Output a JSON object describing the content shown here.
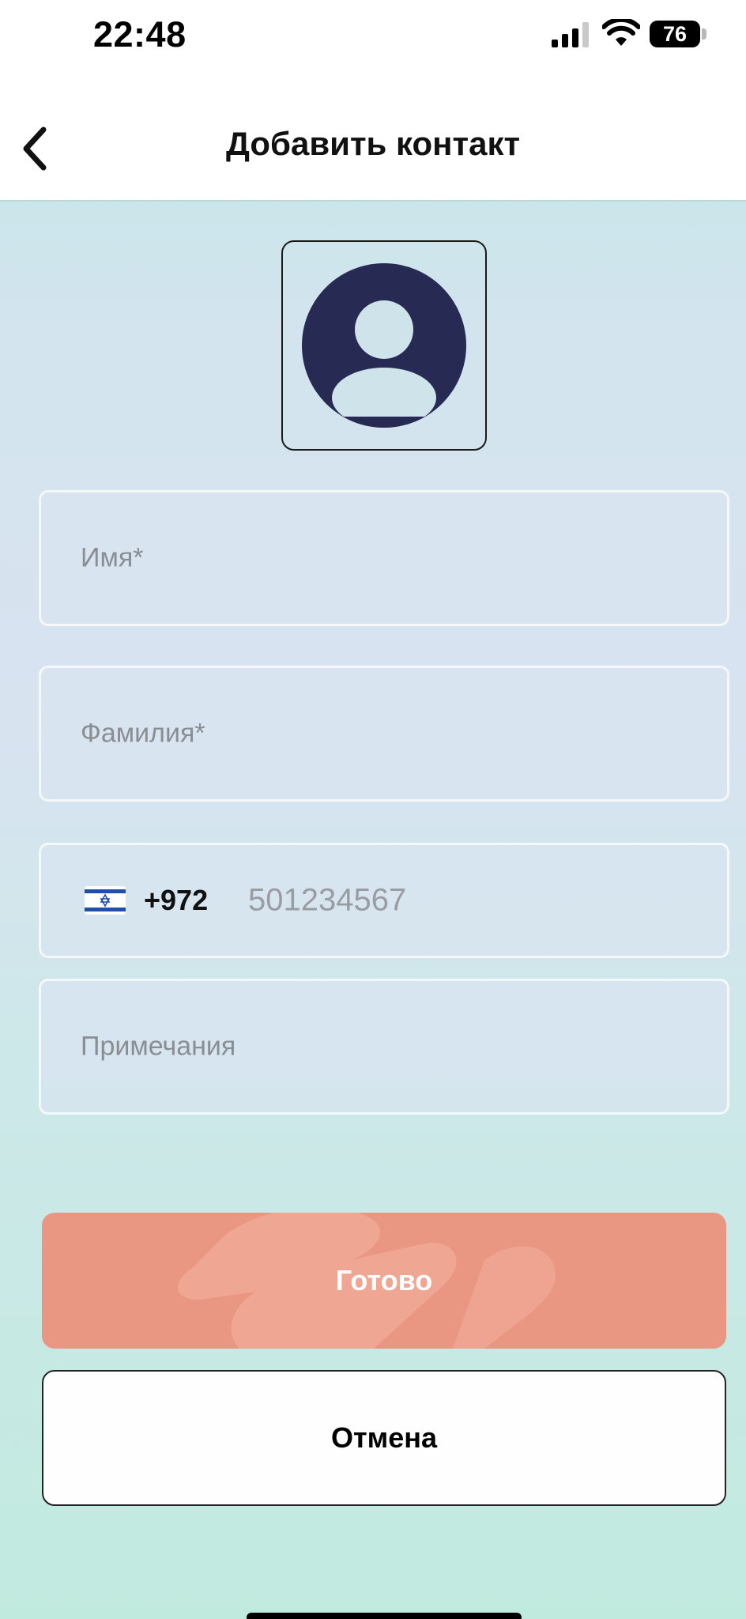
{
  "status_bar": {
    "time": "22:48",
    "battery": "76",
    "icons": [
      "cellular-signal-icon",
      "wifi-icon",
      "battery-icon"
    ]
  },
  "nav": {
    "title": "Добавить контакт",
    "back_icon": "chevron-left-icon"
  },
  "avatar": {
    "icon": "person-avatar-icon"
  },
  "form": {
    "first_name_placeholder": "Имя*",
    "last_name_placeholder": "Фамилия*",
    "phone": {
      "country_flag": "israel-flag-icon",
      "country_code": "+972",
      "placeholder": "501234567"
    },
    "notes_placeholder": "Примечания"
  },
  "buttons": {
    "done": "Готово",
    "cancel": "Отмена"
  },
  "colors": {
    "accent_button": "#e99782",
    "avatar": "#272a52",
    "bg_top": "#bde8e5",
    "bg_bottom": "#c1eadf"
  }
}
